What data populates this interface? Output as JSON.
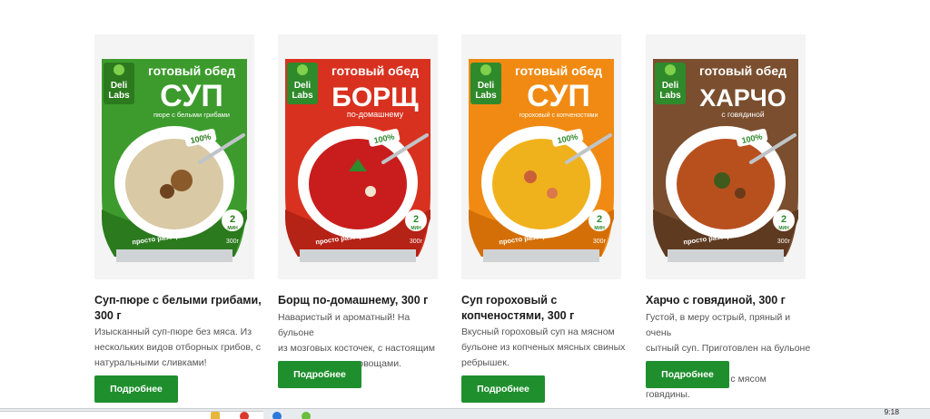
{
  "products": [
    {
      "pouch": {
        "banner": "готовый обед",
        "name": "СУП",
        "sub": "пюре с белыми грибами",
        "percent": "100%",
        "time": "2",
        "time_unit": "МИН",
        "weight": "300г",
        "tag": "просто разогреть",
        "brand_top": "Deli",
        "brand_bottom": "Labs"
      },
      "title": "Суп-пюре с белыми грибами, 300 г",
      "desc_lines": [
        "Изысканный суп-пюре без мяса. Из",
        "нескольких видов отборных грибов, с",
        "натуральными сливками!"
      ],
      "button": "Подробнее",
      "colors": {
        "bag": "#3c9b2c",
        "dark": "#2b7a1e",
        "soup": "#d9c9a4",
        "accent": "#8a5a2a"
      }
    },
    {
      "pouch": {
        "banner": "готовый обед",
        "name": "БОРЩ",
        "sub": "по-домашнему",
        "percent": "100%",
        "time": "2",
        "time_unit": "МИН",
        "weight": "300г",
        "tag": "просто разогреть",
        "brand_top": "Deli",
        "brand_bottom": "Labs"
      },
      "title": "Борщ по-домашнему, 300 г",
      "desc_lines": [
        "Наваристый и ароматный! На бульоне",
        "из мозговых косточек, с настоящим",
        "мясом и свежими овощами."
      ],
      "button": "Подробнее",
      "colors": {
        "bag": "#d9311f",
        "dark": "#b52216",
        "soup": "#c91d1d",
        "accent": "#2f8a2b"
      }
    },
    {
      "pouch": {
        "banner": "готовый обед",
        "name": "СУП",
        "sub": "гороховый с копченостями",
        "percent": "100%",
        "time": "2",
        "time_unit": "МИН",
        "weight": "300г",
        "tag": "просто разогреть",
        "brand_top": "Deli",
        "brand_bottom": "Labs"
      },
      "title": "Суп гороховый с копченостями, 300 г",
      "desc_lines": [
        "Вкусный гороховый суп на мясном",
        "бульоне из копченых мясных свиных",
        "ребрышек."
      ],
      "button": "Подробнее",
      "colors": {
        "bag": "#f08a12",
        "dark": "#d46f08",
        "soup": "#f0b21c",
        "accent": "#c9603a"
      }
    },
    {
      "pouch": {
        "banner": "готовый обед",
        "name": "ХАРЧО",
        "sub": "с говядиной",
        "percent": "100%",
        "time": "2",
        "time_unit": "МИН",
        "weight": "300г",
        "tag": "просто разогреть",
        "brand_top": "Deli",
        "brand_bottom": "Labs"
      },
      "title": "Харчо с говядиной, 300 г",
      "desc_lines": [
        "Густой, в меру острый, пряный и очень",
        "сытный суп. Приготовлен на бульоне из",
        "мозговых косточек с мясом говядины."
      ],
      "button": "Подробнее",
      "colors": {
        "bag": "#7a4e2e",
        "dark": "#5e3a20",
        "soup": "#b8501e",
        "accent": "#3f5a1c"
      }
    }
  ],
  "taskbar": {
    "time": "9:18"
  }
}
